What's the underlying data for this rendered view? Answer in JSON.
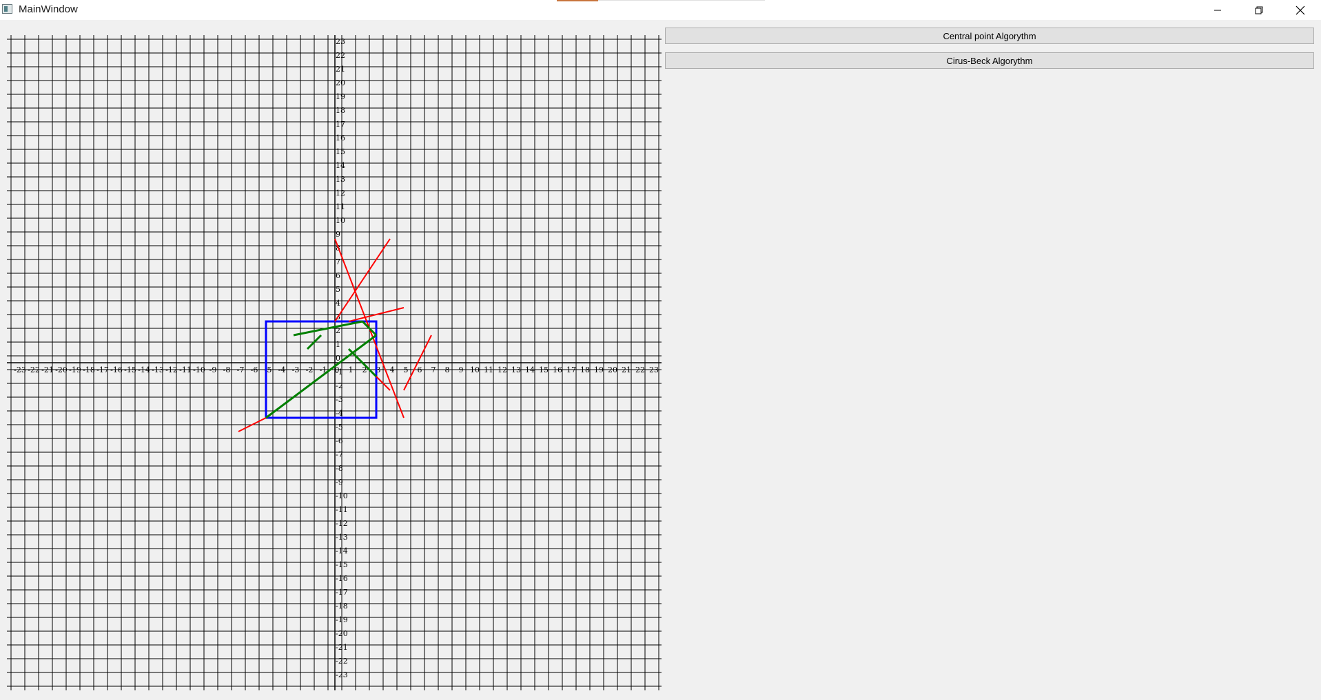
{
  "window": {
    "title": "MainWindow",
    "minimize_icon": "minimize-icon",
    "restore_icon": "restore-icon",
    "close_icon": "close-icon"
  },
  "buttons": {
    "central_point": "Central point Algorythm",
    "cirus_beck": "Cirus-Beck Algorythm"
  },
  "plot": {
    "axis_range": [
      -23,
      23
    ],
    "grid": true,
    "x_ticks": [
      "-23",
      "-22",
      "-21",
      "-20",
      "-19",
      "-18",
      "-17",
      "-16",
      "-15",
      "-14",
      "-13",
      "-12",
      "-11",
      "-10",
      "-9",
      "-8",
      "-7",
      "-6",
      "-5",
      "-4",
      "-3",
      "-2",
      "-1",
      "0",
      "1",
      "2",
      "3",
      "4",
      "5",
      "6",
      "7",
      "8",
      "9",
      "10",
      "11",
      "12",
      "13",
      "14",
      "15",
      "16",
      "17",
      "18",
      "19",
      "20",
      "21",
      "22",
      "23"
    ],
    "y_ticks": [
      "23",
      "22",
      "21",
      "20",
      "19",
      "18",
      "17",
      "16",
      "15",
      "14",
      "13",
      "12",
      "11",
      "10",
      "9",
      "8",
      "7",
      "6",
      "5",
      "4",
      "3",
      "2",
      "1",
      "0",
      "-1",
      "-2",
      "-3",
      "-4",
      "-5",
      "-6",
      "-7",
      "-8",
      "-9",
      "-10",
      "-11",
      "-12",
      "-13",
      "-14",
      "-15",
      "-16",
      "-17",
      "-18",
      "-19",
      "-20",
      "-21",
      "-22",
      "-23"
    ],
    "colors": {
      "grid": "#000000",
      "clip_window": "#0000ff",
      "segment": "#ff0000",
      "clipped": "#008000"
    },
    "clip_window": [
      [
        -5,
        3
      ],
      [
        3,
        3
      ],
      [
        3,
        -4
      ],
      [
        -5,
        -4
      ]
    ],
    "segments": [
      [
        [
          0,
          9
        ],
        [
          5,
          -4
        ]
      ],
      [
        [
          0,
          3
        ],
        [
          4,
          9
        ]
      ],
      [
        [
          1,
          3
        ],
        [
          5,
          4
        ]
      ],
      [
        [
          -7,
          -5
        ],
        [
          -5,
          -4
        ]
      ],
      [
        [
          5,
          -2
        ],
        [
          7,
          2
        ]
      ],
      [
        [
          4,
          -2
        ],
        [
          3,
          -1
        ]
      ]
    ],
    "clipped": [
      [
        [
          -3,
          2
        ],
        [
          2,
          3
        ]
      ],
      [
        [
          -2,
          1
        ],
        [
          -1,
          2
        ]
      ],
      [
        [
          -5,
          -4
        ],
        [
          3,
          2
        ]
      ],
      [
        [
          1,
          1
        ],
        [
          3,
          -1
        ]
      ],
      [
        [
          2,
          3
        ],
        [
          3,
          2
        ]
      ]
    ]
  }
}
